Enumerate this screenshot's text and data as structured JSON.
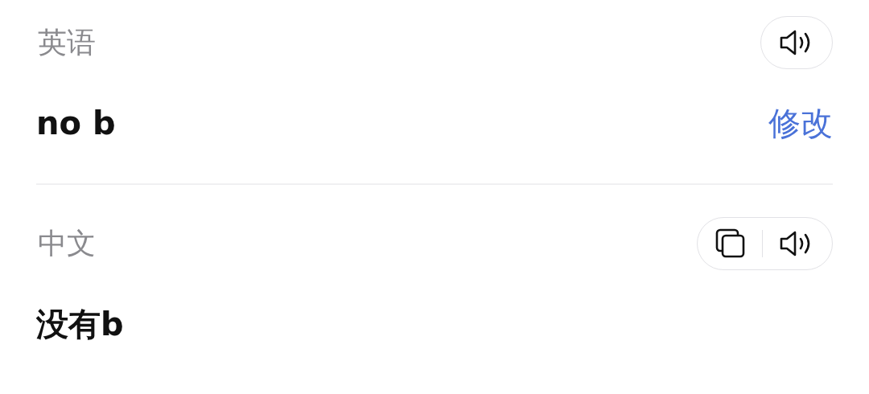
{
  "sections": [
    {
      "language": "英语",
      "text": "no b",
      "edit_link": "修改",
      "actions": [
        {
          "kind": "speaker"
        }
      ]
    },
    {
      "language": "中文",
      "text": "没有b",
      "actions": [
        {
          "kind": "copy"
        },
        {
          "kind": "speaker"
        }
      ]
    }
  ]
}
